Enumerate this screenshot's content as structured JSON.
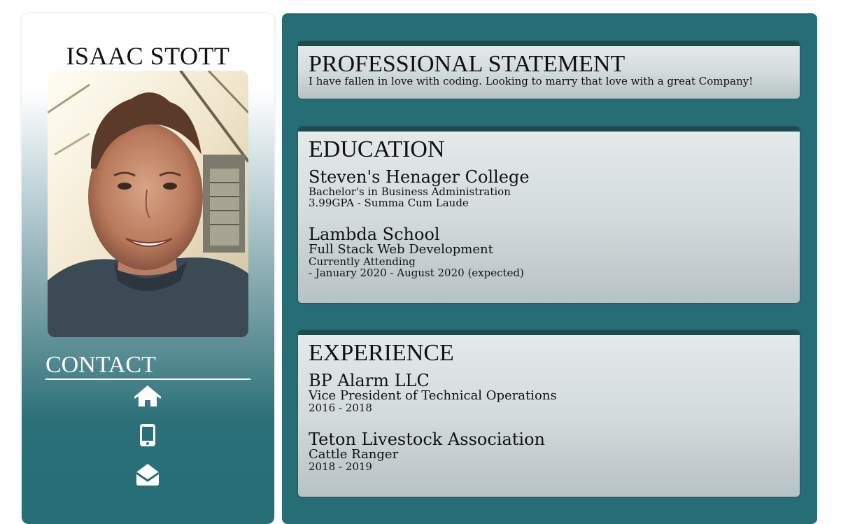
{
  "profile": {
    "name": "ISAAC STOTT",
    "photo_alt": "profile-photo"
  },
  "contact": {
    "title": "CONTACT",
    "icons": [
      "home-icon",
      "mobile-phone-icon",
      "envelope-open-icon"
    ]
  },
  "statement": {
    "title": "PROFESSIONAL STATEMENT",
    "text": "I have fallen in love with coding. Looking to marry that love with a great Company!"
  },
  "education": {
    "title": "EDUCATION",
    "entries": [
      {
        "school": "Steven's Henager College",
        "line1": "Bachelor's in Business Administration",
        "line2": "3.99GPA - Summa Cum Laude"
      },
      {
        "school": "Lambda School",
        "program": "Full Stack Web Development",
        "line1": "Currently Attending",
        "line2": "- January 2020 - August 2020 (expected)"
      }
    ]
  },
  "experience": {
    "title": "EXPERIENCE",
    "entries": [
      {
        "company": "BP Alarm LLC",
        "role": "Vice President of Technical Operations",
        "dates": "2016 - 2018"
      },
      {
        "company": "Teton Livestock Association",
        "role": "Cattle Ranger",
        "dates": "2018 - 2019"
      }
    ]
  },
  "colors": {
    "main_bg": "#266d75",
    "card_top_border": "#214a4f",
    "card_bg_top": "#e4e9ea",
    "card_bg_bottom": "#b7c2c4"
  }
}
